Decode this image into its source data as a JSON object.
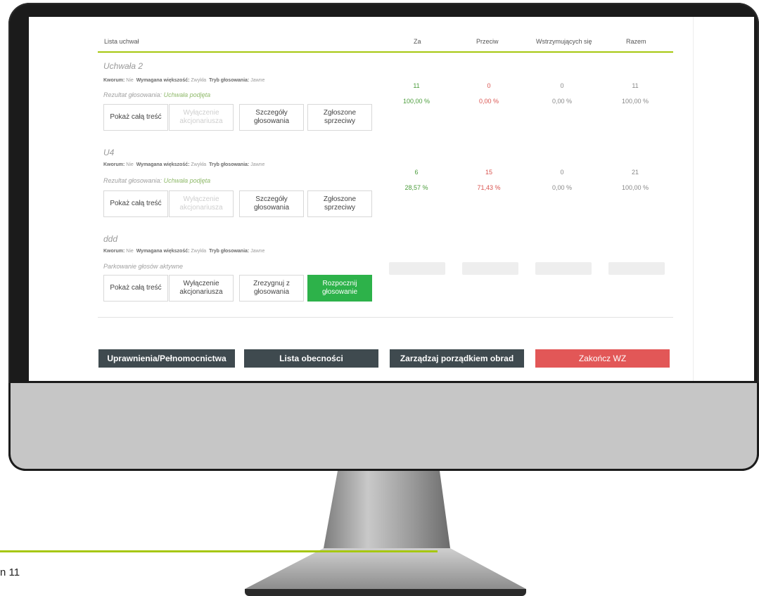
{
  "table": {
    "headers": {
      "list": "Lista uchwał",
      "za": "Za",
      "przeciw": "Przeciw",
      "wstrzymujacych": "Wstrzymujących się",
      "razem": "Razem"
    }
  },
  "meta_labels": {
    "kworum": "Kworum:",
    "wiekszosc": "Wymagana większość:",
    "tryb": "Tryb głosowania:"
  },
  "resolutions": [
    {
      "name": "Uchwała 2",
      "kworum": "Nie",
      "wiekszosc": "Zwykła",
      "tryb": "Jawne",
      "status_prefix": "Rezultat głosowania:",
      "status_value": "Uchwała podjęta",
      "buttons": [
        "Pokaż całą treść",
        "Wyłączenie akcjonariusza",
        "Szczegóły głosowania",
        "Zgłoszone sprzeciwy"
      ],
      "za": {
        "count": "11",
        "pct": "100,00 %"
      },
      "przeciw": {
        "count": "0",
        "pct": "0,00 %"
      },
      "wstrzymujacych": {
        "count": "0",
        "pct": "0,00 %"
      },
      "razem": {
        "count": "11",
        "pct": "100,00 %"
      }
    },
    {
      "name": "U4",
      "kworum": "Nie",
      "wiekszosc": "Zwykła",
      "tryb": "Jawne",
      "status_prefix": "Rezultat głosowania:",
      "status_value": "Uchwała podjęta",
      "buttons": [
        "Pokaż całą treść",
        "Wyłączenie akcjonariusza",
        "Szczegóły głosowania",
        "Zgłoszone sprzeciwy"
      ],
      "za": {
        "count": "6",
        "pct": "28,57 %"
      },
      "przeciw": {
        "count": "15",
        "pct": "71,43 %"
      },
      "wstrzymujacych": {
        "count": "0",
        "pct": "0,00 %"
      },
      "razem": {
        "count": "21",
        "pct": "100,00 %"
      }
    },
    {
      "name": "ddd",
      "kworum": "Nie",
      "wiekszosc": "Zwykła",
      "tryb": "Jawne",
      "status_text": "Parkowanie głosów aktywne",
      "buttons": [
        "Pokaż całą treść",
        "Wyłączenie akcjonariusza",
        "Zrezygnuj z głosowania",
        "Rozpocznij głosowanie"
      ]
    }
  ],
  "actions": {
    "uprawnienia": "Uprawnienia/Pełnomocnictwa",
    "lista_obecnosci": "Lista obecności",
    "porzadek": "Zarządzaj porządkiem obrad",
    "zakoncz": "Zakończ WZ"
  },
  "colors": {
    "accent_green": "#a6c70f",
    "button_green": "#2db24a",
    "button_dark": "#3f4a4f",
    "button_red": "#e25757"
  },
  "page_number": "n 11"
}
